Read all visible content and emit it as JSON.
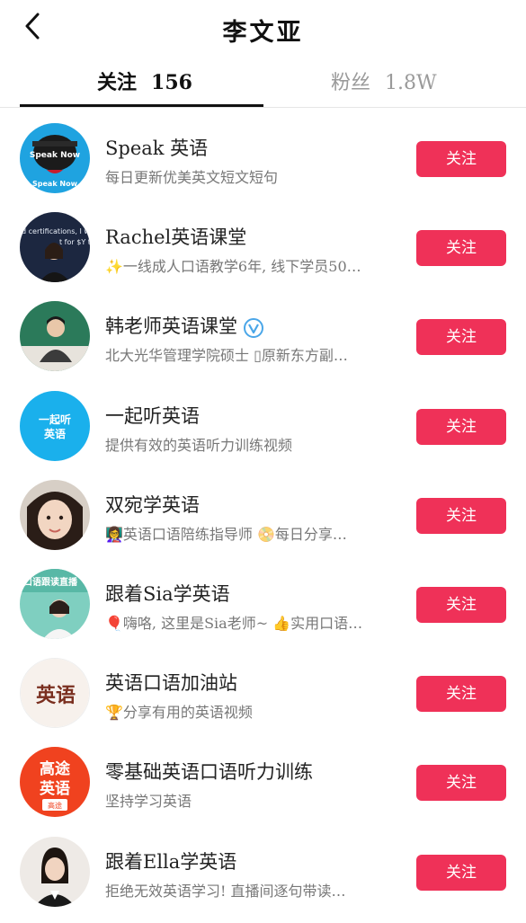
{
  "header": {
    "title": "李文亚",
    "back_icon": "chevron-left-icon"
  },
  "tabs": [
    {
      "label": "关注",
      "count": "156",
      "active": true
    },
    {
      "label": "粉丝",
      "count": "1.8W",
      "active": false
    }
  ],
  "colors": {
    "follow_button": "#ef3158",
    "verified_badge": "#4aa6e8"
  },
  "users": [
    {
      "name": "Speak  英语",
      "desc": "每日更新优美英文短文短句",
      "button": "关注",
      "avatar_text": [
        "Speak Now",
        "Speak Now"
      ]
    },
    {
      "name": "Rachel英语课堂",
      "desc": "✨一线成人口语教学6年, 线下学员50…",
      "button": "关注",
      "avatar_text": [
        "d certifications, I w",
        "t for $Y to"
      ]
    },
    {
      "name": "韩老师英语课堂",
      "desc": "北大光华管理学院硕士 ▯原新东方副…",
      "button": "关注",
      "verified": true
    },
    {
      "name": "一起听英语",
      "desc": "提供有效的英语听力训练视频",
      "button": "关注",
      "avatar_text": [
        "一起听",
        "英语"
      ]
    },
    {
      "name": "双宛学英语",
      "desc": "👩‍🏫英语口语陪练指导师 📀每日分享…",
      "button": "关注"
    },
    {
      "name": "跟着Sia学英语",
      "desc": "🎈嗨咯, 这里是Sia老师~ 👍实用口语…",
      "button": "关注",
      "avatar_text": [
        "口语跟读直播"
      ]
    },
    {
      "name": "英语口语加油站",
      "desc": "🏆分享有用的英语视频",
      "button": "关注",
      "avatar_text": [
        "英语"
      ]
    },
    {
      "name": "零基础英语口语听力训练",
      "desc": "坚持学习英语",
      "button": "关注",
      "avatar_text": [
        "高途",
        "英语",
        "高途"
      ]
    },
    {
      "name": "跟着Ella学英语",
      "desc": "拒绝无效英语学习! 直播间逐句带读…",
      "button": "关注"
    }
  ]
}
